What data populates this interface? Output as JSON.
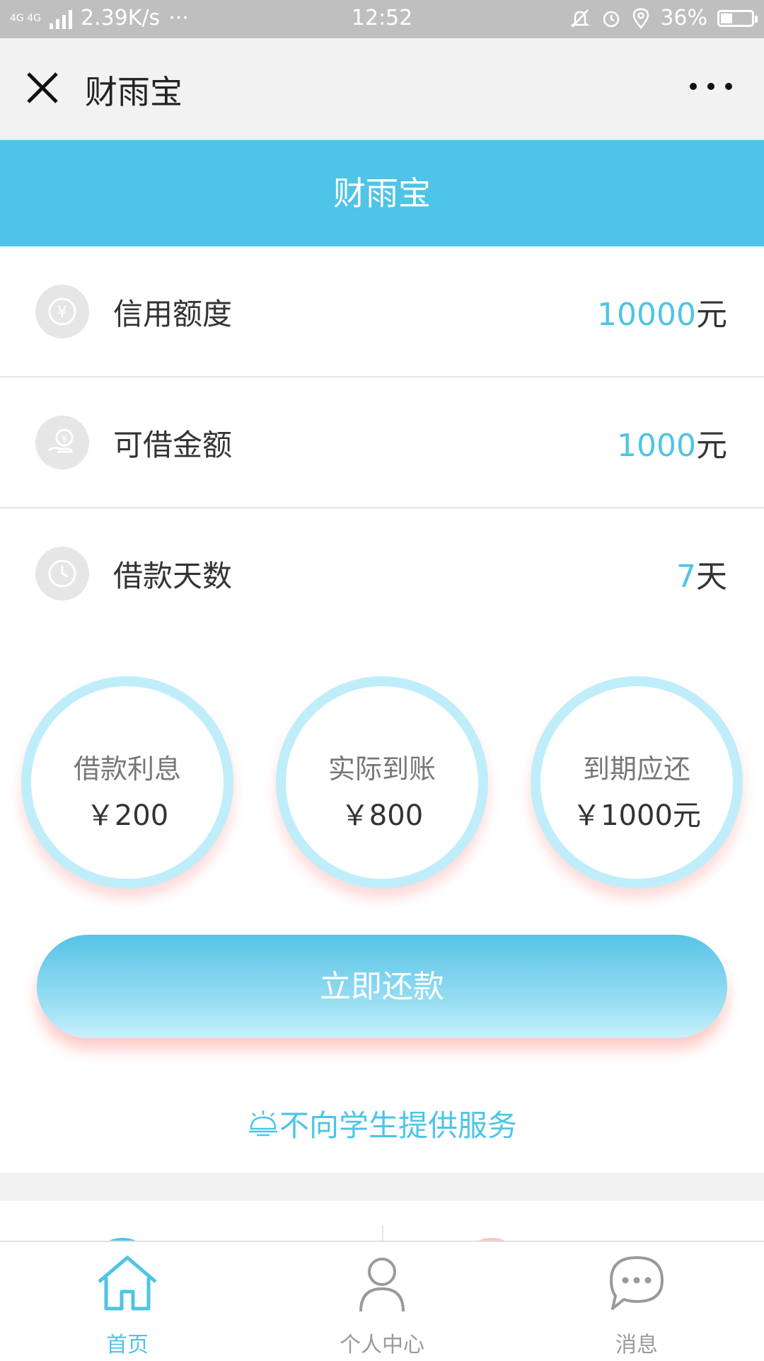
{
  "status_bar": {
    "network": "4G 4G",
    "speed": "2.39K/s",
    "dots": "···",
    "time": "12:52",
    "battery": "36%"
  },
  "nav": {
    "title": "财雨宝"
  },
  "header": {
    "title": "财雨宝"
  },
  "info_rows": [
    {
      "label": "信用额度",
      "value": "10000",
      "unit": "元"
    },
    {
      "label": "可借金额",
      "value": "1000",
      "unit": "元"
    },
    {
      "label": "借款天数",
      "value": "7",
      "unit": "天"
    }
  ],
  "circles": [
    {
      "label": "借款利息",
      "value": "￥200"
    },
    {
      "label": "实际到账",
      "value": "￥800"
    },
    {
      "label": "到期应还",
      "value": "￥1000元"
    }
  ],
  "repay_button": {
    "label": "立即还款"
  },
  "notice": {
    "text": "不向学生提供服务"
  },
  "tabs": [
    {
      "label": "首页",
      "icon": "home-icon",
      "active": true
    },
    {
      "label": "个人中心",
      "icon": "user-icon",
      "active": false
    },
    {
      "label": "消息",
      "icon": "message-icon",
      "active": false
    }
  ],
  "colors": {
    "accent": "#4ec4e6",
    "status_bar": "#bfbfbf",
    "nav_bar": "#f2f2f2",
    "inactive_tab": "#9a9a9a"
  }
}
